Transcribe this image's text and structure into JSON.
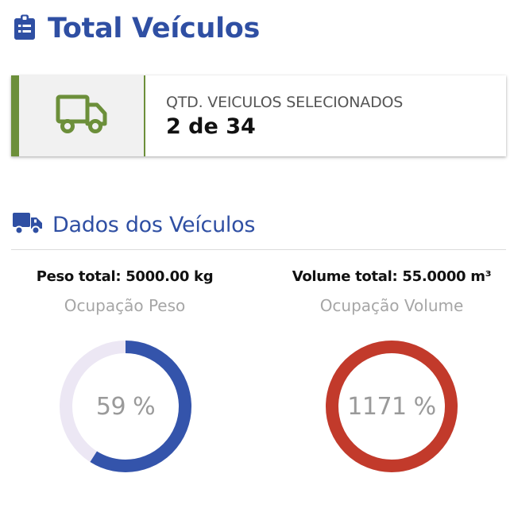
{
  "header": {
    "title": "Total Veículos",
    "icon": "clipboard-icon",
    "color": "#2f4fa3"
  },
  "summary_card": {
    "label": "QTD. VEICULOS SELECIONADOS",
    "value": "2 de 34",
    "icon": "truck-icon",
    "accent_color": "#6c8f3a"
  },
  "vehicle_data": {
    "title": "Dados dos Veículos",
    "icon": "truck-icon",
    "weight": {
      "total_label": "Peso total: 5000.00 kg",
      "occupation_label": "Ocupação Peso",
      "percent_text": "59 %",
      "percent": 59,
      "color": "#3454ab",
      "track_color": "#ece7f4"
    },
    "volume": {
      "total_label": "Volume total: 55.0000 m³",
      "occupation_label": "Ocupação Volume",
      "percent_text": "1171 %",
      "percent": 1171,
      "color": "#c23a2b",
      "track_color": "#ece7f4"
    }
  }
}
